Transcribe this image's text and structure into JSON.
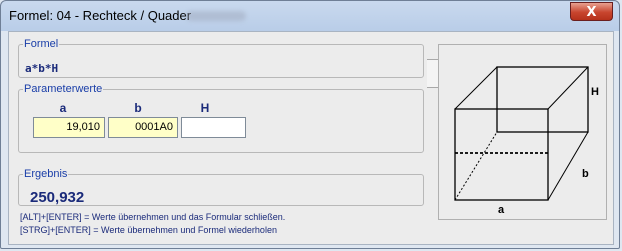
{
  "window": {
    "title": "Formel: 04 - Rechteck / Quader",
    "close_symbol": "X"
  },
  "formel": {
    "legend": "Formel",
    "expression": "a*b*H"
  },
  "parameter": {
    "legend": "Parameterwerte",
    "labels": [
      "a",
      "b",
      "H"
    ],
    "values": [
      "19,010",
      "0001A0",
      ""
    ]
  },
  "ergebnis": {
    "legend": "Ergebnis",
    "value": "250,932"
  },
  "hints": [
    "[ALT]+[ENTER] = Werte übernehmen und das Formular schließen.",
    "[STRG]+[ENTER] = Werte übernehmen und Formel wiederholen"
  ],
  "diagram": {
    "label_a": "a",
    "label_b": "b",
    "label_h": "H"
  },
  "colors": {
    "accent": "#1a3ea8",
    "input_active": "#ffffc8",
    "close_button": "#c8452e"
  }
}
